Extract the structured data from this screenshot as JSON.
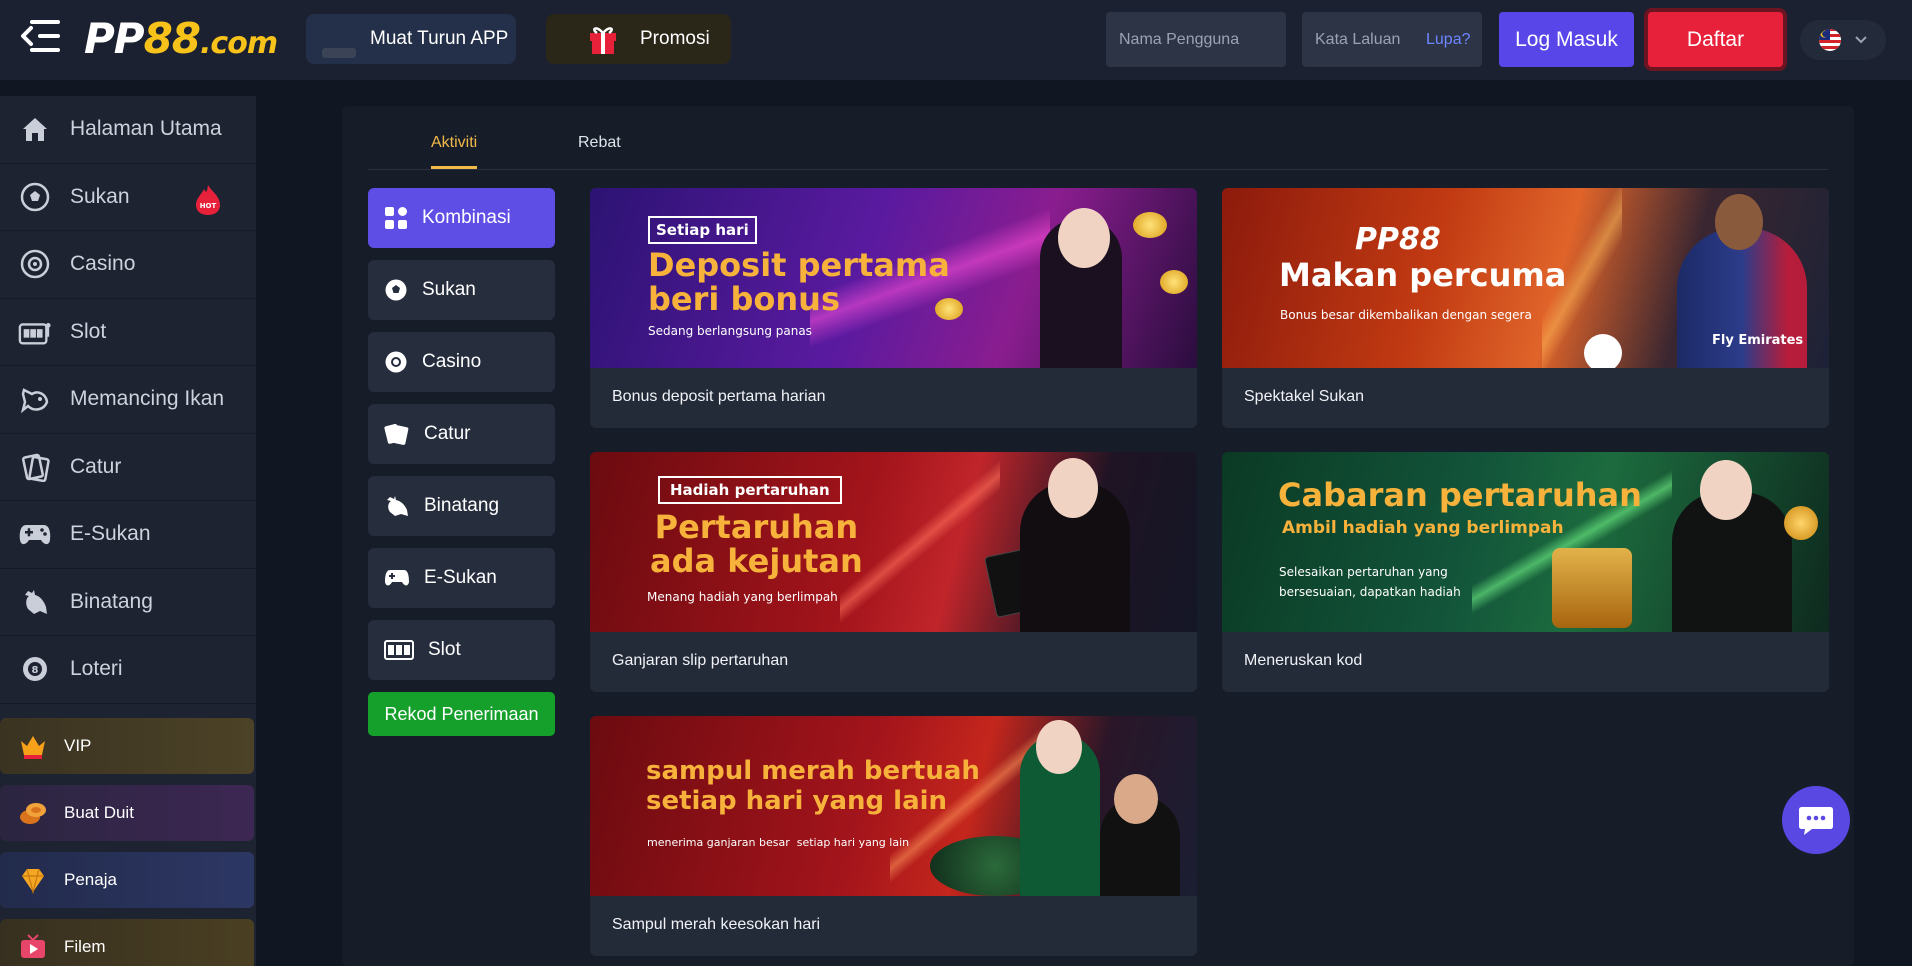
{
  "header": {
    "logo_main": "PP",
    "logo_num": "88",
    "logo_tld": ".com",
    "app_label": "Muat Turun APP",
    "promo_label": "Promosi",
    "username_placeholder": "Nama Pengguna",
    "password_placeholder": "Kata Laluan",
    "forgot_label": "Lupa?",
    "login_label": "Log Masuk",
    "register_label": "Daftar",
    "language": "malaysia-flag-icon"
  },
  "sidebar": {
    "items": [
      {
        "label": "Halaman Utama",
        "icon": "home-icon"
      },
      {
        "label": "Sukan",
        "icon": "soccer-ball-icon"
      },
      {
        "label": "Casino",
        "icon": "casino-chip-icon"
      },
      {
        "label": "Slot",
        "icon": "slot-machine-icon"
      },
      {
        "label": "Memancing Ikan",
        "icon": "fish-icon"
      },
      {
        "label": "Catur",
        "icon": "cards-icon"
      },
      {
        "label": "E-Sukan",
        "icon": "gamepad-icon"
      },
      {
        "label": "Binatang",
        "icon": "rooster-icon"
      },
      {
        "label": "Loteri",
        "icon": "lottery-ball-icon"
      }
    ],
    "hot_badge": "HOT",
    "promos": [
      {
        "label": "VIP",
        "icon": "vip-crown-icon"
      },
      {
        "label": "Buat Duit",
        "icon": "coins-icon"
      },
      {
        "label": "Penaja",
        "icon": "diamond-icon"
      },
      {
        "label": "Filem",
        "icon": "tv-icon"
      }
    ]
  },
  "main": {
    "tabs": [
      {
        "label": "Aktiviti",
        "active": true
      },
      {
        "label": "Rebat",
        "active": false
      }
    ],
    "categories": [
      {
        "label": "Kombinasi",
        "active": true,
        "icon": "grid-icon"
      },
      {
        "label": "Sukan",
        "active": false,
        "icon": "soccer-ball-icon"
      },
      {
        "label": "Casino",
        "active": false,
        "icon": "casino-chip-icon"
      },
      {
        "label": "Catur",
        "active": false,
        "icon": "cards-icon"
      },
      {
        "label": "Binatang",
        "active": false,
        "icon": "rooster-icon"
      },
      {
        "label": "E-Sukan",
        "active": false,
        "icon": "gamepad-icon"
      },
      {
        "label": "Slot",
        "active": false,
        "icon": "slot-machine-icon"
      }
    ],
    "record_label": "Rekod Penerimaan",
    "cards": [
      {
        "title": "Bonus deposit pertama harian",
        "tag": "Setiap hari",
        "headline1": "Deposit pertama",
        "headline2": "beri bonus",
        "sub": "Sedang berlangsung panas"
      },
      {
        "title": "Spektakel Sukan",
        "brand": "PP88",
        "headline1": "Makan percuma",
        "sub": "Bonus besar dikembalikan dengan segera",
        "jersey": "Fly Emirates"
      },
      {
        "title": "Ganjaran slip pertaruhan",
        "tag": "Hadiah pertaruhan",
        "headline1": "Pertaruhan",
        "headline2": "ada kejutan",
        "sub": "Menang hadiah yang berlimpah"
      },
      {
        "title": "Meneruskan kod",
        "headline1": "Cabaran pertaruhan",
        "headline2": "Ambil hadiah yang berlimpah",
        "sub1": "Selesaikan pertaruhan yang",
        "sub2": "bersesuaian, dapatkan hadiah"
      },
      {
        "title": "Sampul merah keesokan hari",
        "headline1": "sampul merah bertuah",
        "headline2": "setiap hari yang lain",
        "sub": "menerima ganjaran besar  setiap hari yang lain"
      }
    ]
  },
  "colors": {
    "accent_purple": "#5f4ee6",
    "register_red": "#e8213b",
    "gold": "#f2b94a",
    "record_green": "#14a02a"
  }
}
